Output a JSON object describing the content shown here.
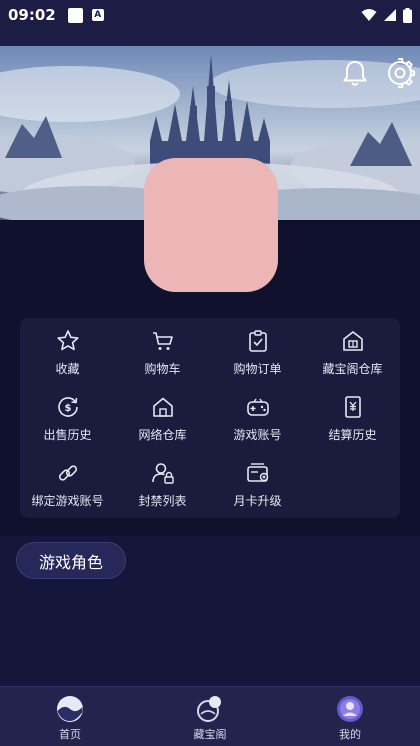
{
  "status": {
    "time": "09:02",
    "badge": "A"
  },
  "header": {
    "bell": "bell-icon",
    "settings": "gear-icon"
  },
  "features": [
    {
      "label": "收藏",
      "icon": "star-icon"
    },
    {
      "label": "购物车",
      "icon": "cart-icon"
    },
    {
      "label": "购物订单",
      "icon": "order-icon"
    },
    {
      "label": "藏宝阁仓库",
      "icon": "warehouse-icon"
    },
    {
      "label": "出售历史",
      "icon": "sale-history-icon"
    },
    {
      "label": "网络仓库",
      "icon": "house-icon"
    },
    {
      "label": "游戏账号",
      "icon": "gamepad-icon"
    },
    {
      "label": "结算历史",
      "icon": "receipt-icon"
    },
    {
      "label": "绑定游戏账号",
      "icon": "link-icon"
    },
    {
      "label": "封禁列表",
      "icon": "user-lock-icon"
    },
    {
      "label": "月卡升级",
      "icon": "card-icon"
    }
  ],
  "roles": {
    "label": "游戏角色"
  },
  "nav": [
    {
      "label": "首页",
      "icon": "home-planet-icon"
    },
    {
      "label": "藏宝阁",
      "icon": "treasure-icon"
    },
    {
      "label": "我的",
      "icon": "profile-icon"
    }
  ],
  "colors": {
    "background": "#15173a",
    "card": "#1a1c3e",
    "avatar": "#ecb6b7",
    "nav": "#23244e"
  }
}
